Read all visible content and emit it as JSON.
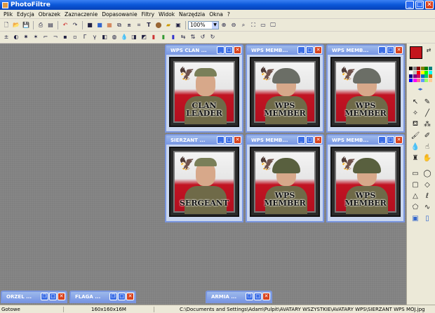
{
  "app": {
    "title": "PhotoFiltre"
  },
  "menu": [
    "Plik",
    "Edycja",
    "Obrazek",
    "Zaznaczenie",
    "Dopasowanie",
    "Filtry",
    "Widok",
    "Narzędzia",
    "Okna",
    "?"
  ],
  "toolbar": {
    "zoom": "100%"
  },
  "windows": [
    {
      "title": "WPS CLAN ...",
      "label_line1": "CLAN",
      "label_line2": "LEADER",
      "headgear": "cap"
    },
    {
      "title": "WPS MEMB...",
      "label_line1": "WPS MEMBER",
      "label_line2": "",
      "headgear": "helmet-grey"
    },
    {
      "title": "WPS MEMB...",
      "label_line1": "WPS MEMBER",
      "label_line2": "",
      "headgear": "helmet-grey"
    },
    {
      "title": "SIERŻANT ...",
      "label_line1": "SERGEANT",
      "label_line2": "",
      "headgear": "cap"
    },
    {
      "title": "WPS MEMB...",
      "label_line1": "WPS MEMBER",
      "label_line2": "",
      "headgear": "helmet"
    },
    {
      "title": "WPS MEMB...",
      "label_line1": "WPS MEMBER",
      "label_line2": "",
      "headgear": "helmet"
    }
  ],
  "minimized": [
    {
      "title": "ORZEL ..."
    },
    {
      "title": "FLAGA ..."
    },
    {
      "title": "ARMIA ..."
    }
  ],
  "status": {
    "state": "Gotowe",
    "dims": "160x160x16M",
    "path": "C:\\Documents and Settings\\Adam\\Pulpit\\AVATARY WSZYSTKIE\\AVATARY WPS\\SIERŻANT WPS MÓJ.jpg"
  },
  "colors": {
    "foreground": "#c4151c",
    "background": "#ffffff",
    "titlebar": "#0a56d8"
  }
}
